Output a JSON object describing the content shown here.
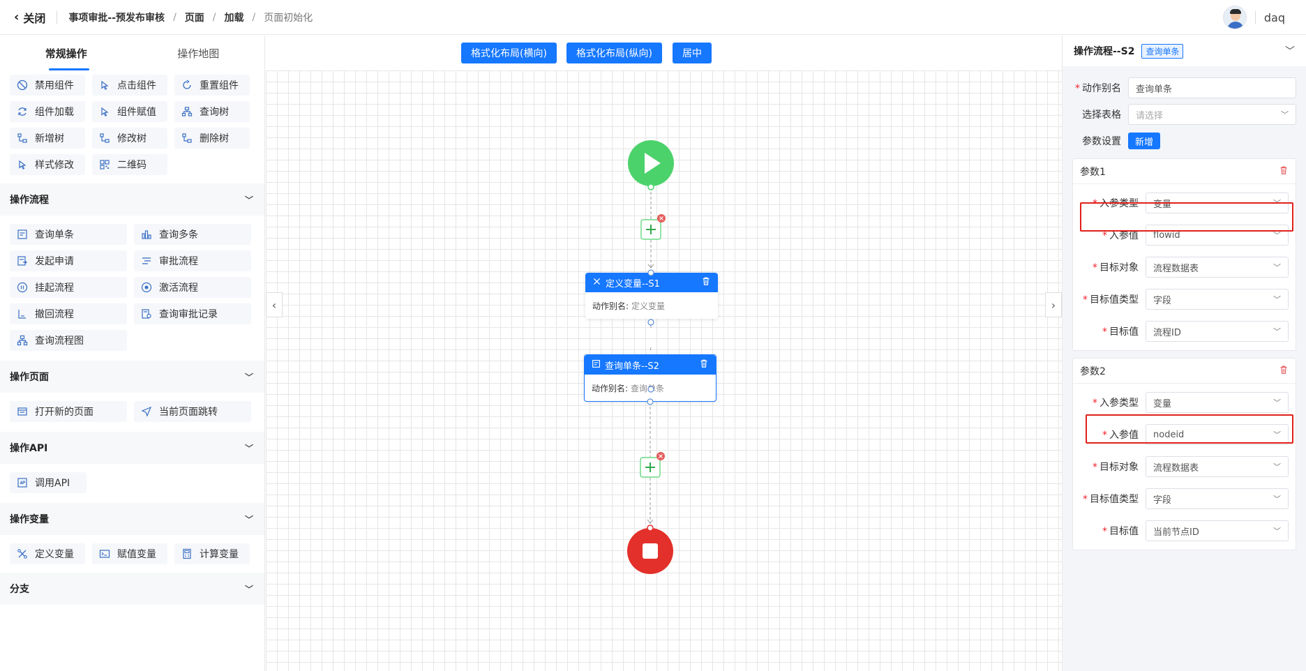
{
  "header": {
    "close_label": "关闭",
    "breadcrumb": [
      "事项审批--预发布审核",
      "页面",
      "加载",
      "页面初始化"
    ],
    "user_name": "daq"
  },
  "left": {
    "tabs": [
      "常规操作",
      "操作地图"
    ],
    "top_items": [
      "禁用组件",
      "点击组件",
      "重置组件",
      "组件加载",
      "组件赋值",
      "查询树",
      "新增树",
      "修改树",
      "删除树",
      "样式修改",
      "二维码"
    ],
    "sections": [
      {
        "title": "操作流程",
        "items": [
          "查询单条",
          "查询多条",
          "发起申请",
          "审批流程",
          "挂起流程",
          "激活流程",
          "撤回流程",
          "查询审批记录",
          "查询流程图"
        ]
      },
      {
        "title": "操作页面",
        "items": [
          "打开新的页面",
          "当前页面跳转"
        ]
      },
      {
        "title": "操作API",
        "items": [
          "调用API"
        ]
      },
      {
        "title": "操作变量",
        "items": [
          "定义变量",
          "赋值变量",
          "计算变量"
        ]
      },
      {
        "title": "分支",
        "items": []
      }
    ]
  },
  "canvas": {
    "buttons": [
      "格式化布局(横向)",
      "格式化布局(纵向)",
      "居中"
    ],
    "nodes": [
      {
        "title": "定义变量--S1",
        "alias_label": "动作别名:",
        "alias_value": "定义变量"
      },
      {
        "title": "查询单条--S2",
        "alias_label": "动作别名:",
        "alias_value": "查询单条"
      }
    ]
  },
  "right": {
    "title": "操作流程--S2",
    "tag": "查询单条",
    "fields": {
      "alias_label": "动作别名",
      "alias_value": "查询单条",
      "table_label": "选择表格",
      "table_placeholder": "请选择",
      "params_label": "参数设置",
      "add_label": "新增"
    },
    "params": [
      {
        "name": "参数1",
        "rows": [
          {
            "label": "入参类型",
            "value": "变量"
          },
          {
            "label": "入参值",
            "value": "flowid"
          },
          {
            "label": "目标对象",
            "value": "流程数据表"
          },
          {
            "label": "目标值类型",
            "value": "字段"
          },
          {
            "label": "目标值",
            "value": "流程ID"
          }
        ]
      },
      {
        "name": "参数2",
        "rows": [
          {
            "label": "入参类型",
            "value": "变量"
          },
          {
            "label": "入参值",
            "value": "nodeid"
          },
          {
            "label": "目标对象",
            "value": "流程数据表"
          },
          {
            "label": "目标值类型",
            "value": "字段"
          },
          {
            "label": "目标值",
            "value": "当前节点ID"
          }
        ]
      }
    ]
  },
  "colors": {
    "primary": "#1677ff",
    "start": "#4cd26b",
    "end": "#e3302b",
    "highlight": "#e0201a"
  }
}
